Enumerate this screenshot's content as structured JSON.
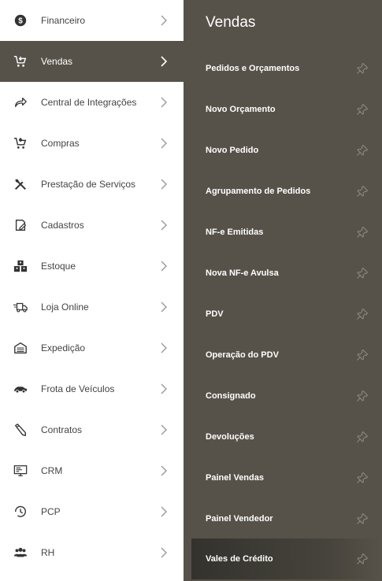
{
  "sidebar": {
    "items": [
      {
        "label": "Financeiro",
        "icon": "dollar-circle-icon"
      },
      {
        "label": "Vendas",
        "icon": "cart-icon",
        "active": true
      },
      {
        "label": "Central de Integrações",
        "icon": "share-arrow-icon"
      },
      {
        "label": "Compras",
        "icon": "cart-icon"
      },
      {
        "label": "Prestação de Serviços",
        "icon": "tools-icon"
      },
      {
        "label": "Cadastros",
        "icon": "edit-document-icon"
      },
      {
        "label": "Estoque",
        "icon": "boxes-icon"
      },
      {
        "label": "Loja Online",
        "icon": "delivery-truck-icon"
      },
      {
        "label": "Expedição",
        "icon": "warehouse-icon"
      },
      {
        "label": "Frota de Veículos",
        "icon": "car-icon"
      },
      {
        "label": "Contratos",
        "icon": "pen-icon"
      },
      {
        "label": "CRM",
        "icon": "monitor-icon"
      },
      {
        "label": "PCP",
        "icon": "clock-icon"
      },
      {
        "label": "RH",
        "icon": "people-icon"
      }
    ]
  },
  "submenu": {
    "title": "Vendas",
    "items": [
      {
        "label": "Pedidos e Orçamentos"
      },
      {
        "label": "Novo Orçamento"
      },
      {
        "label": "Novo Pedido"
      },
      {
        "label": "Agrupamento de Pedidos"
      },
      {
        "label": "NF-e Emitidas"
      },
      {
        "label": "Nova NF-e Avulsa"
      },
      {
        "label": "PDV"
      },
      {
        "label": "Operação do PDV"
      },
      {
        "label": "Consignado"
      },
      {
        "label": "Devoluções"
      },
      {
        "label": "Painel Vendas"
      },
      {
        "label": "Painel Vendedor"
      },
      {
        "label": "Vales de Crédito",
        "highlighted": true
      }
    ]
  },
  "colors": {
    "panel": "#575249",
    "text_dark": "#444444",
    "text_light": "#ffffff",
    "pin": "#8a8780"
  }
}
